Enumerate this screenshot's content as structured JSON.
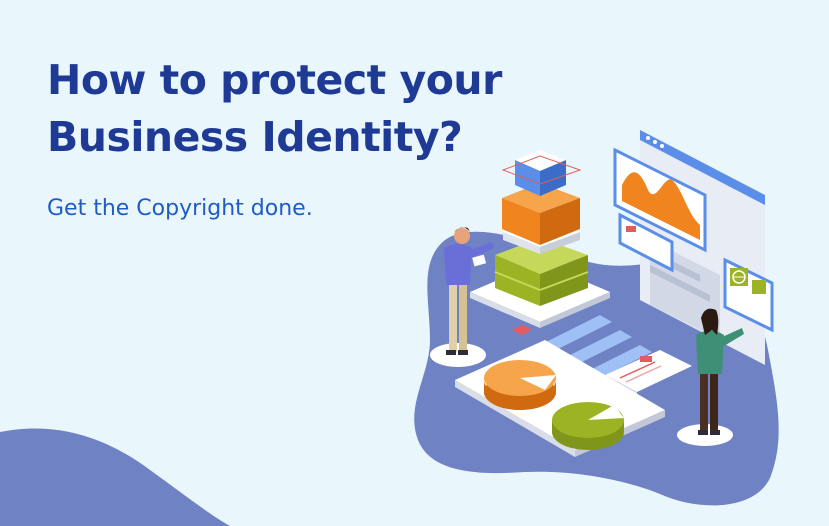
{
  "headline": {
    "line1": "How to protect your",
    "line2": "Business Identity?"
  },
  "subheadline": "Get the Copyright done.",
  "colors": {
    "background": "#e9f6fc",
    "headline": "#1e3a94",
    "subheadline": "#1f5cc4",
    "blob": "#6f82c4",
    "orange": "#f0851f",
    "olive": "#9cb423",
    "screen_blue": "#5a8ee8"
  },
  "illustration": {
    "icons": [
      "stacked-boxes-icon",
      "pie-chart-icon",
      "browser-window-icon",
      "area-chart-icon",
      "globe-icon",
      "document-icon",
      "man-figure-icon",
      "woman-figure-icon"
    ]
  }
}
